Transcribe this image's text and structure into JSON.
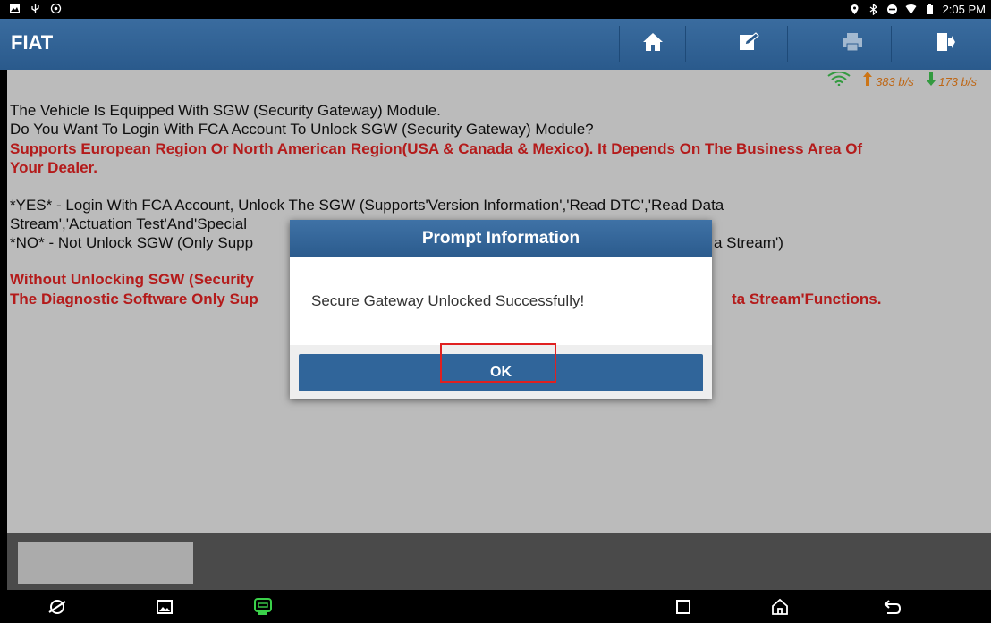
{
  "status_bar": {
    "time": "2:05 PM"
  },
  "app": {
    "title": "FIAT"
  },
  "toolbar": {
    "icons": [
      "home-icon",
      "edit-icon",
      "print-icon",
      "exit-icon"
    ]
  },
  "speeds": {
    "upload": "383 b/s",
    "download": "173 b/s"
  },
  "content": {
    "line1": "The Vehicle Is Equipped With SGW (Security Gateway) Module.",
    "line2": "Do You Want To Login With FCA Account To Unlock SGW (Security Gateway) Module?",
    "red1": "Supports European Region Or North American Region(USA & Canada & Mexico). It Depends On The Business Area Of",
    "red2": "Your Dealer.",
    "yes1": "*YES* - Login With FCA Account, Unlock The SGW (Supports'Version Information','Read DTC','Read Data",
    "yes2": "Stream','Actuation Test'And'Special",
    "no1a": "*NO* - Not Unlock SGW (Only Supp",
    "no1b": "a Stream')",
    "red3a": "Without Unlocking SGW (Security",
    "red4a": "The Diagnostic Software Only Sup",
    "red4b": "ta Stream'Functions."
  },
  "dialog": {
    "title": "Prompt Information",
    "message": "Secure Gateway Unlocked Successfully!",
    "ok_label": "OK"
  },
  "colors": {
    "accent": "#2b5b8d",
    "warning_text": "#d42020",
    "highlight": "#e02020"
  }
}
